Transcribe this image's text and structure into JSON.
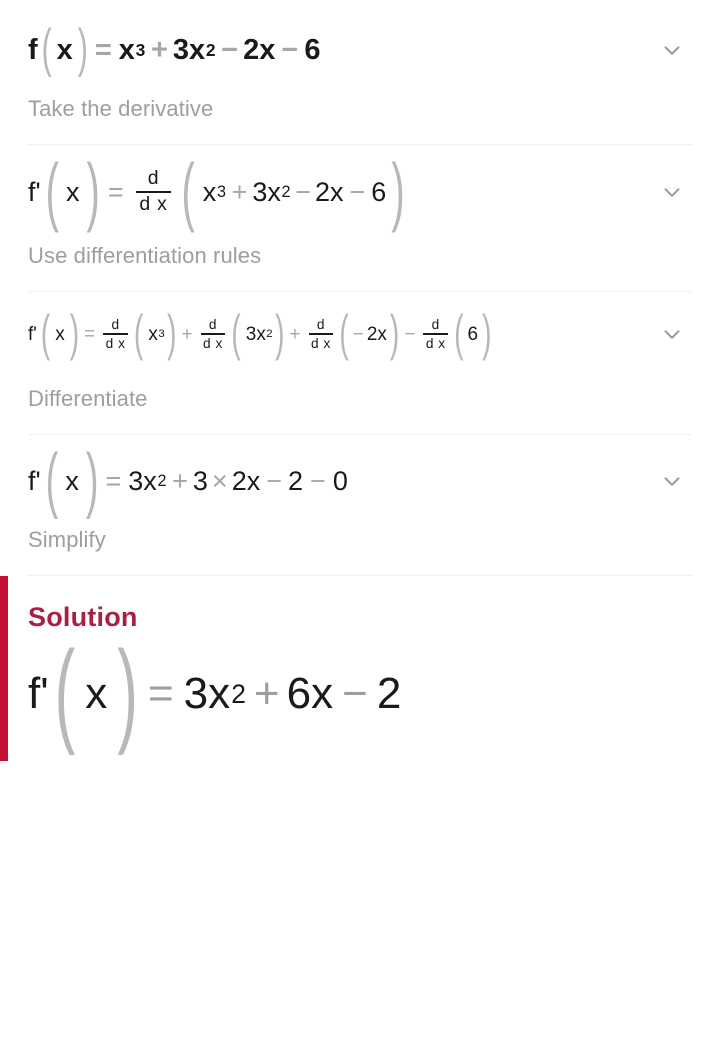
{
  "page": {
    "type": "math-step-by-step-solution",
    "background": "#ffffff"
  },
  "colors": {
    "text_primary": "#1a1a1a",
    "operator_gray": "#a6a6a6",
    "paren_gray": "#b0b0b0",
    "step_label_gray": "#9e9e9e",
    "divider": "#f1f1f1",
    "accent_red": "#c41237",
    "solution_title_red": "#a82145"
  },
  "icons": {
    "chevron_down": "chevron-down-icon"
  },
  "steps": [
    {
      "id": "step-1",
      "label": "Take the derivative",
      "has_chevron": true,
      "equation_text": "f(x) = x^3 + 3x^2 - 2x - 6",
      "tokens": {
        "lhs_f": "f",
        "lhs_prime": "",
        "paren_open": "(",
        "lhs_var": "x",
        "paren_close": ")",
        "eq": "=",
        "t1_base": "x",
        "t1_exp": "3",
        "op1": "+",
        "t2_coef": "3x",
        "t2_exp": "2",
        "op2": "−",
        "t3": "2x",
        "op3": "−",
        "t4": "6"
      }
    },
    {
      "id": "step-2",
      "label": "Use differentiation rules",
      "has_chevron": true,
      "equation_text": "f'(x) = d/dx ( x^3 + 3x^2 - 2x - 6 )",
      "tokens": {
        "lhs_f": "f",
        "lhs_prime": "'",
        "paren_open": "(",
        "lhs_var": "x",
        "paren_close": ")",
        "eq": "=",
        "frac_num": "d",
        "frac_den": "d x",
        "group_open": "(",
        "t1_base": "x",
        "t1_exp": "3",
        "op1": "+",
        "t2_coef": "3x",
        "t2_exp": "2",
        "op2": "−",
        "t3": "2x",
        "op3": "−",
        "t4": "6",
        "group_close": ")"
      }
    },
    {
      "id": "step-3",
      "label": "Differentiate",
      "has_chevron": true,
      "equation_text": "f'(x) = d/dx(x^3) + d/dx(3x^2) + d/dx(-2x) - d/dx(6)",
      "tokens": {
        "lhs_f": "f",
        "lhs_prime": "'",
        "paren_open": "(",
        "lhs_var": "x",
        "paren_close": ")",
        "eq": "=",
        "frac_num": "d",
        "frac_den": "d x",
        "g1_open": "(",
        "g1_base": "x",
        "g1_exp": "3",
        "g1_close": ")",
        "op1": "+",
        "g2_open": "(",
        "g2_base": "3x",
        "g2_exp": "2",
        "g2_close": ")",
        "op2": "+",
        "g3_open": "(",
        "g3_sign": "−",
        "g3_body": "2x",
        "g3_close": ")",
        "op3": "−",
        "g4_open": "(",
        "g4_body": "6",
        "g4_close": ")"
      }
    },
    {
      "id": "step-4",
      "label": "Simplify",
      "has_chevron": true,
      "equation_text": "f'(x) = 3x^2 + 3 × 2x - 2 - 0",
      "tokens": {
        "lhs_f": "f",
        "lhs_prime": "'",
        "paren_open": "(",
        "lhs_var": "x",
        "paren_close": ")",
        "eq": "=",
        "t1_coef": "3x",
        "t1_exp": "2",
        "op1": "+",
        "t2a": "3",
        "times": "×",
        "t2b": "2x",
        "op2": "−",
        "t3": "2",
        "op3": "−",
        "t4": "0"
      }
    }
  ],
  "solution": {
    "title": "Solution",
    "equation_text": "f'(x) = 3x^2 + 6x - 2",
    "tokens": {
      "lhs_f": "f",
      "lhs_prime": "'",
      "paren_open": "(",
      "lhs_var": "x",
      "paren_close": ")",
      "eq": "=",
      "t1_coef": "3x",
      "t1_exp": "2",
      "op1": "+",
      "t2": "6x",
      "op2": "−",
      "t3": "2"
    }
  }
}
